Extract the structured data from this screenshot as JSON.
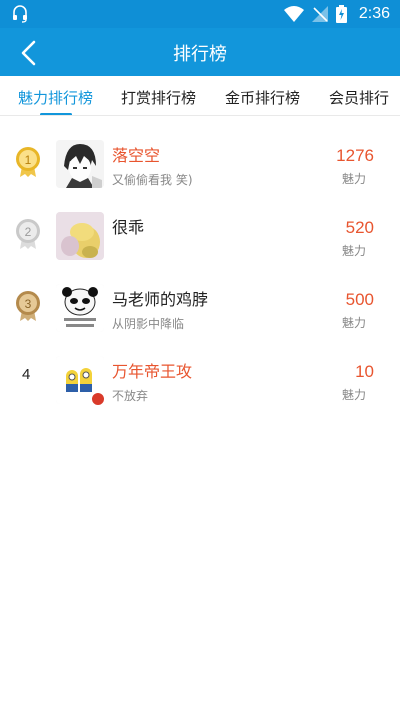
{
  "app": {
    "title": "排行榜",
    "time": "2:36"
  },
  "tabs": [
    {
      "label": "魅力排行榜",
      "active": true
    },
    {
      "label": "打赏排行榜",
      "active": false
    },
    {
      "label": "金币排行榜",
      "active": false
    },
    {
      "label": "会员排行",
      "active": false
    }
  ],
  "leaderboard": [
    {
      "rank": "1",
      "badge": "gold-medal-icon",
      "name": "落空空",
      "name_highlight": true,
      "signature": "又偷偷看我 笑)",
      "score": "1276",
      "score_label": "魅力",
      "avatar": "anime-boy-avatar"
    },
    {
      "rank": "2",
      "badge": "silver-medal-icon",
      "name": "很乖",
      "name_highlight": false,
      "signature": "",
      "score": "520",
      "score_label": "魅力",
      "avatar": "yellow-hat-avatar"
    },
    {
      "rank": "3",
      "badge": "bronze-medal-icon",
      "name": "马老师的鸡脖",
      "name_highlight": false,
      "signature": "从阴影中降临",
      "score": "500",
      "score_label": "魅力",
      "avatar": "panda-meme-avatar"
    },
    {
      "rank": "4",
      "badge": null,
      "name": "万年帝王攻",
      "name_highlight": true,
      "signature": "不放弃",
      "score": "10",
      "score_label": "魅力",
      "avatar": "minions-avatar"
    }
  ],
  "colors": {
    "primary": "#1296db",
    "status_bar": "#0f8fd6",
    "highlight": "#e8552f",
    "gold": "#e8b628",
    "silver": "#c9c9c9",
    "bronze": "#b48a4c"
  }
}
